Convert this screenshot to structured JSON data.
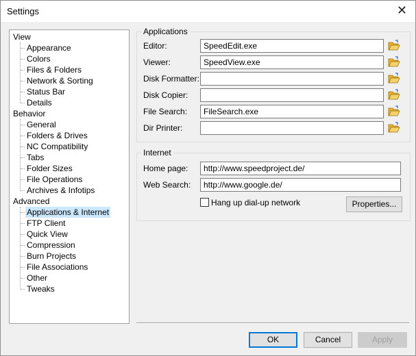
{
  "window": {
    "title": "Settings"
  },
  "tree": {
    "items": [
      {
        "label": "View",
        "level": 0
      },
      {
        "label": "Appearance",
        "level": 1
      },
      {
        "label": "Colors",
        "level": 1
      },
      {
        "label": "Files & Folders",
        "level": 1
      },
      {
        "label": "Network & Sorting",
        "level": 1
      },
      {
        "label": "Status Bar",
        "level": 1
      },
      {
        "label": "Details",
        "level": 1
      },
      {
        "label": "Behavior",
        "level": 0
      },
      {
        "label": "General",
        "level": 1
      },
      {
        "label": "Folders & Drives",
        "level": 1
      },
      {
        "label": "NC Compatibility",
        "level": 1
      },
      {
        "label": "Tabs",
        "level": 1
      },
      {
        "label": "Folder Sizes",
        "level": 1
      },
      {
        "label": "File Operations",
        "level": 1
      },
      {
        "label": "Archives & Infotips",
        "level": 1
      },
      {
        "label": "Advanced",
        "level": 0
      },
      {
        "label": "Applications & Internet",
        "level": 1,
        "selected": true
      },
      {
        "label": "FTP Client",
        "level": 1
      },
      {
        "label": "Quick View",
        "level": 1
      },
      {
        "label": "Compression",
        "level": 1
      },
      {
        "label": "Burn Projects",
        "level": 1
      },
      {
        "label": "File Associations",
        "level": 1
      },
      {
        "label": "Other",
        "level": 1
      },
      {
        "label": "Tweaks",
        "level": 1
      }
    ]
  },
  "applications": {
    "title": "Applications",
    "fields": [
      {
        "label": "Editor:",
        "value": "SpeedEdit.exe"
      },
      {
        "label": "Viewer:",
        "value": "SpeedView.exe"
      },
      {
        "label": "Disk Formatter:",
        "value": ""
      },
      {
        "label": "Disk Copier:",
        "value": ""
      },
      {
        "label": "File Search:",
        "value": "FileSearch.exe"
      },
      {
        "label": "Dir Printer:",
        "value": ""
      }
    ]
  },
  "internet": {
    "title": "Internet",
    "home_label": "Home page:",
    "home_value": "http://www.speedproject.de/",
    "search_label": "Web Search:",
    "search_value": "http://www.google.de/",
    "hangup_label": "Hang up dial-up network",
    "hangup_checked": false,
    "properties_label": "Properties..."
  },
  "buttons": {
    "ok": "OK",
    "cancel": "Cancel",
    "apply": "Apply"
  },
  "icons": {
    "close": "close-icon",
    "folder": "open-folder-icon"
  },
  "colors": {
    "selection": "#cce8ff",
    "accent": "#0078d7",
    "folder_yellow": "#f5c542"
  }
}
